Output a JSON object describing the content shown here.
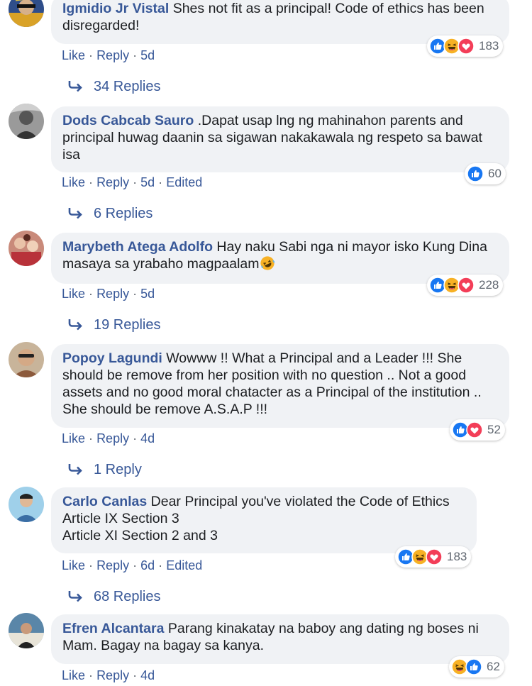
{
  "comments": [
    {
      "name": "Igmidio Jr Vistal",
      "text": "Shes not fit as a principal! Code of ethics has been disregarded!",
      "like": "Like",
      "reply": "Reply",
      "time": "5d",
      "edited": "",
      "reaction_count": "183",
      "reactions": [
        "like",
        "haha",
        "love"
      ],
      "replies": "34 Replies"
    },
    {
      "name": "Dods Cabcab Sauro",
      "text": ".Dapat usap lng ng mahinahon parents and principal huwag daanin sa sigawan nakakawala ng respeto sa bawat isa",
      "like": "Like",
      "reply": "Reply",
      "time": "5d",
      "edited": "Edited",
      "reaction_count": "60",
      "reactions": [
        "like"
      ],
      "replies": "6 Replies"
    },
    {
      "name": "Marybeth Atega Adolfo",
      "text": "Hay naku Sabi nga ni mayor isko Kung Dina masaya sa yrabaho magpaalam",
      "like": "Like",
      "reply": "Reply",
      "time": "5d",
      "edited": "",
      "reaction_count": "228",
      "reactions": [
        "like",
        "haha",
        "love"
      ],
      "replies": "19 Replies"
    },
    {
      "name": "Popoy Lagundi",
      "text": "Wowww !! What a Principal and a Leader !!! She should be remove from her position with no question .. Not a good assets and no good moral chatacter as a Principal of the institution .. She should be remove A.S.A.P !!!",
      "like": "Like",
      "reply": "Reply",
      "time": "4d",
      "edited": "",
      "reaction_count": "52",
      "reactions": [
        "like",
        "love"
      ],
      "replies": "1 Reply"
    },
    {
      "name": "Carlo Canlas",
      "text_lines": [
        "Dear Principal you've violated the Code of Ethics",
        "Article IX Section 3",
        "Article XI Section 2 and 3"
      ],
      "like": "Like",
      "reply": "Reply",
      "time": "6d",
      "edited": "Edited",
      "reaction_count": "183",
      "reactions": [
        "like",
        "haha",
        "love"
      ],
      "replies": "68 Replies"
    },
    {
      "name": "Efren Alcantara",
      "text": "Parang kinakatay na baboy ang dating ng boses ni Mam. Bagay na bagay sa kanya.",
      "like": "Like",
      "reply": "Reply",
      "time": "4d",
      "edited": "",
      "reaction_count": "62",
      "reactions": [
        "haha",
        "like"
      ]
    }
  ],
  "separator": "·",
  "colors": {
    "link": "#385898",
    "bubble": "#f0f2f5",
    "like": "#1877f2",
    "love": "#f33e58",
    "haha": "#f7b125"
  },
  "icons": {
    "reply_arrow": "reply-arrow-icon",
    "inline_emoji": "rolling-laughing-emoji"
  }
}
